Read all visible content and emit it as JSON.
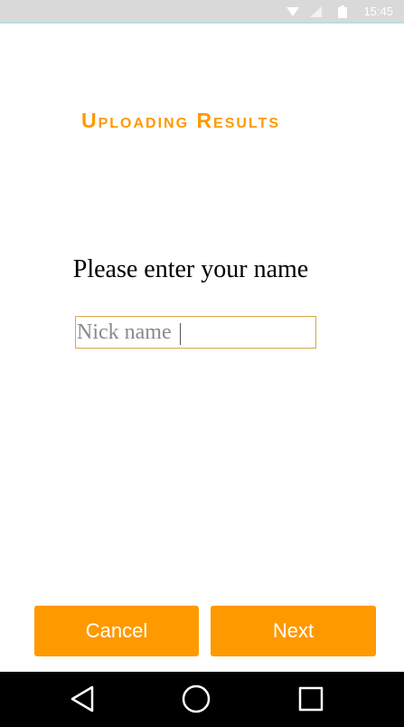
{
  "status_bar": {
    "time": "15:45",
    "icons": [
      "wifi-icon",
      "signal-icon",
      "battery-icon"
    ],
    "background": "#d9d9d9"
  },
  "app": {
    "title": "Uploading Results",
    "accent_color": "#ff9900"
  },
  "form": {
    "prompt": "Please enter your name",
    "name_input": {
      "value": "",
      "placeholder": "Nick name"
    }
  },
  "buttons": {
    "cancel_label": "Cancel",
    "next_label": "Next"
  },
  "nav_bar": {
    "icons": [
      "back-icon",
      "home-icon",
      "recents-icon"
    ]
  }
}
